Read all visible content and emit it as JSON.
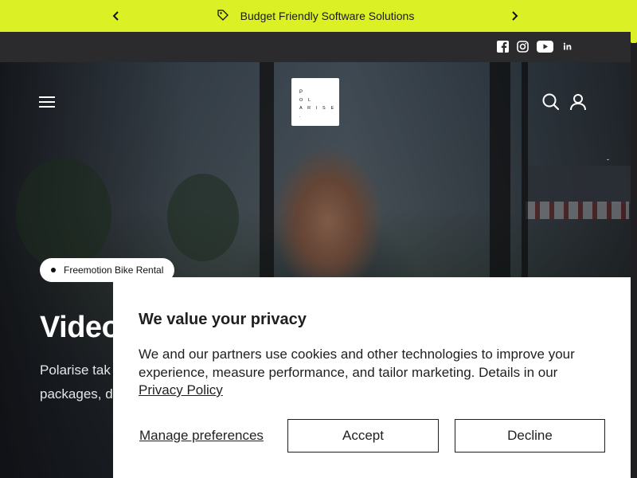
{
  "announcement": {
    "text": "Budget Friendly Software Solutions",
    "prev_icon": "chevron-left-icon",
    "next_icon": "chevron-right-icon",
    "tag_icon": "tag-icon",
    "background": "#dcf026"
  },
  "social": {
    "items": [
      {
        "name": "facebook-icon"
      },
      {
        "name": "instagram-icon"
      },
      {
        "name": "youtube-icon"
      },
      {
        "name": "linkedin-icon"
      }
    ]
  },
  "header": {
    "menu_icon": "hamburger-menu-icon",
    "logo_lines": [
      "P",
      "O L",
      "A R I S E ."
    ],
    "search_icon": "search-icon",
    "account_icon": "user-icon",
    "tick": "-"
  },
  "hero": {
    "badge": "Freemotion Bike Rental",
    "title": "Video",
    "text_line1": "Polarise tak",
    "text_line2": "packages, d"
  },
  "cookie_banner": {
    "title": "We value your privacy",
    "description": "We and our partners use cookies and other technologies to improve your experience, measure performance, and tailor marketing. Details in our",
    "policy_link": "Privacy Policy",
    "manage_label": "Manage preferences",
    "accept_label": "Accept",
    "decline_label": "Decline"
  }
}
